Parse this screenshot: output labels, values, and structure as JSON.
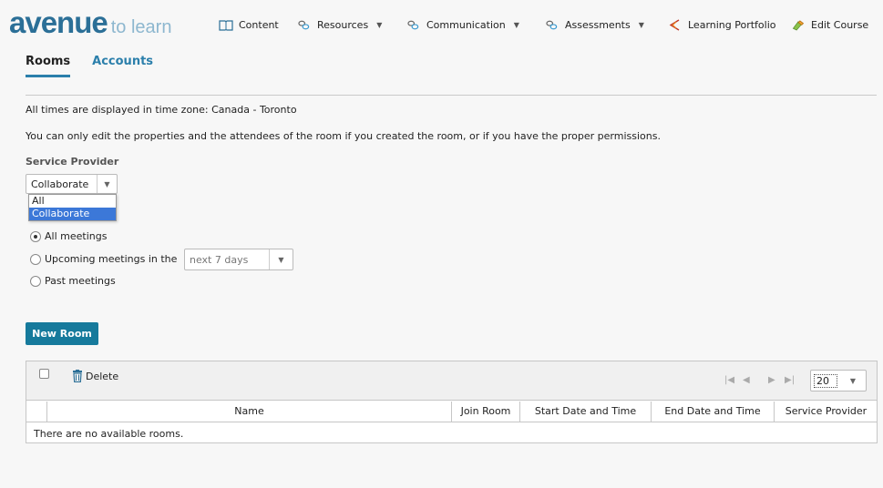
{
  "brand": {
    "main": "avenue",
    "sub": "to learn"
  },
  "nav": {
    "content": "Content",
    "resources": "Resources",
    "communication": "Communication",
    "assessments": "Assessments",
    "learning_portfolio": "Learning Portfolio",
    "edit_course": "Edit Course"
  },
  "tabs": [
    {
      "label": "Rooms",
      "active": true
    },
    {
      "label": "Accounts",
      "active": false
    }
  ],
  "timezone_note": "All times are displayed in time zone: Canada - Toronto",
  "permissions_note": "You can only edit the properties and the attendees of the room if you created the room, or if you have the proper permissions.",
  "service_provider": {
    "label": "Service Provider",
    "selected": "Collaborate",
    "options": [
      "All",
      "Collaborate"
    ]
  },
  "filters": {
    "all_meetings": "All meetings",
    "upcoming": "Upcoming meetings in the",
    "upcoming_range": "next 7 days",
    "past": "Past meetings",
    "selected": "all_meetings"
  },
  "new_room_button": "New Room",
  "grid": {
    "delete_label": "Delete",
    "page_size": "20",
    "columns": [
      "Name",
      "Join Room",
      "Start Date and Time",
      "End Date and Time",
      "Service Provider"
    ],
    "empty_message": "There are no available rooms."
  },
  "colors": {
    "accent": "#167a9c",
    "link": "#2b7fab",
    "brand": "#2b6f97"
  }
}
